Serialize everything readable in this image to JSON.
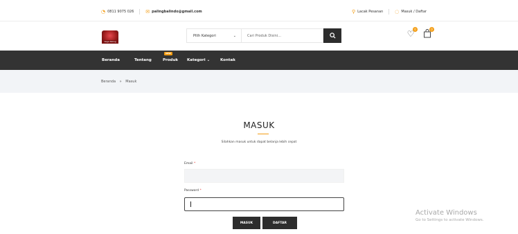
{
  "topbar": {
    "phone": "0811 9075 026",
    "email": "palingbalindo@gmail.com",
    "track_order": "Lacak Pesanan",
    "login_register": "Masuk / Daftar"
  },
  "header": {
    "logo_text": "Vega Paling",
    "search": {
      "category_value": "Pilih Kategori",
      "placeholder": "Cari Produk Disini..."
    },
    "wishlist_count": "0",
    "cart_count": "0"
  },
  "nav": {
    "items": [
      {
        "label": "Beranda"
      },
      {
        "label": "Tentang"
      },
      {
        "label": "Produk",
        "badge": "NEW"
      },
      {
        "label": "Kategori"
      },
      {
        "label": "Kontak"
      }
    ]
  },
  "breadcrumb": {
    "home": "Beranda",
    "separator": "»",
    "current": "Masuk"
  },
  "login": {
    "title": "MASUK",
    "subtitle": "Silahkan masuk untuk dapat belanja lebih cepat",
    "email_label": "Email",
    "password_label": "Password",
    "required_mark": "*",
    "login_button": "MASUK",
    "register_button": "DAFTAR"
  },
  "watermark": {
    "line1": "Activate Windows",
    "line2": "Go to Settings to activate Windows."
  },
  "colors": {
    "accent": "#f39c12",
    "nav_bg": "#333333",
    "button_bg": "#2d2d2d",
    "breadcrumb_bg": "#f2f4f7"
  }
}
